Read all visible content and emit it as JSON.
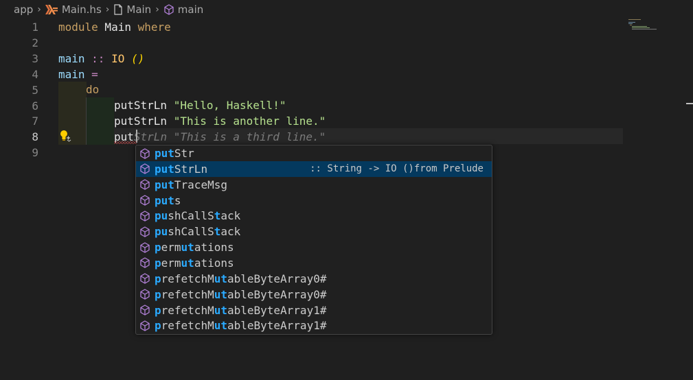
{
  "breadcrumb": {
    "items": [
      "app",
      "Main.hs",
      "Main",
      "main"
    ]
  },
  "editor": {
    "line_numbers": [
      "1",
      "2",
      "3",
      "4",
      "5",
      "6",
      "7",
      "8",
      "9"
    ],
    "active_line": "8",
    "lines": {
      "l1_kw1": "module",
      "l1_name": " Main ",
      "l1_kw2": "where",
      "l3_name": "main",
      "l3_op": " :: ",
      "l3_type": "IO",
      "l3_unit": " ()",
      "l4_name": "main",
      "l4_op": " =",
      "l5_kw": "do",
      "l6_fn": "putStrLn",
      "l6_str": " \"Hello, Haskell!\"",
      "l7_fn": "putStrLn",
      "l7_str": " \"This is another line.\"",
      "l8_typed": "put",
      "l8_ghost": "StrLn",
      "l8_str": " \"This is a third line.\""
    }
  },
  "suggestions": [
    {
      "parts": [
        [
          "put",
          true
        ],
        [
          "Str",
          false
        ]
      ],
      "detail": ""
    },
    {
      "parts": [
        [
          "put",
          true
        ],
        [
          "StrLn",
          false
        ]
      ],
      "detail": ":: String -> IO ()from Prelude",
      "selected": true
    },
    {
      "parts": [
        [
          "put",
          true
        ],
        [
          "TraceMsg",
          false
        ]
      ],
      "detail": ""
    },
    {
      "parts": [
        [
          "put",
          true
        ],
        [
          "s",
          false
        ]
      ],
      "detail": ""
    },
    {
      "parts": [
        [
          "pu",
          true
        ],
        [
          "shCallS",
          false
        ],
        [
          "t",
          true
        ],
        [
          "ack",
          false
        ]
      ],
      "detail": ""
    },
    {
      "parts": [
        [
          "pu",
          true
        ],
        [
          "shCallS",
          false
        ],
        [
          "t",
          true
        ],
        [
          "ack",
          false
        ]
      ],
      "detail": ""
    },
    {
      "parts": [
        [
          "p",
          true
        ],
        [
          "erm",
          false
        ],
        [
          "ut",
          true
        ],
        [
          "ations",
          false
        ]
      ],
      "detail": ""
    },
    {
      "parts": [
        [
          "p",
          true
        ],
        [
          "erm",
          false
        ],
        [
          "ut",
          true
        ],
        [
          "ations",
          false
        ]
      ],
      "detail": ""
    },
    {
      "parts": [
        [
          "p",
          true
        ],
        [
          "refetchM",
          false
        ],
        [
          "ut",
          true
        ],
        [
          "ableByteArray0#",
          false
        ]
      ],
      "detail": ""
    },
    {
      "parts": [
        [
          "p",
          true
        ],
        [
          "refetchM",
          false
        ],
        [
          "ut",
          true
        ],
        [
          "ableByteArray0#",
          false
        ]
      ],
      "detail": ""
    },
    {
      "parts": [
        [
          "p",
          true
        ],
        [
          "refetchM",
          false
        ],
        [
          "ut",
          true
        ],
        [
          "ableByteArray1#",
          false
        ]
      ],
      "detail": ""
    },
    {
      "parts": [
        [
          "p",
          true
        ],
        [
          "refetchM",
          false
        ],
        [
          "ut",
          true
        ],
        [
          "ableByteArray1#",
          false
        ]
      ],
      "detail": ""
    }
  ],
  "colors": {
    "background": "#1f1f1f",
    "selected_suggestion": "#04395e",
    "match_highlight": "#2aaaff",
    "error_squiggle": "#f14c4c"
  },
  "icons": [
    "chevron-right-icon",
    "haskell-icon",
    "file-icon",
    "cube-icon",
    "lightbulb-icon"
  ]
}
